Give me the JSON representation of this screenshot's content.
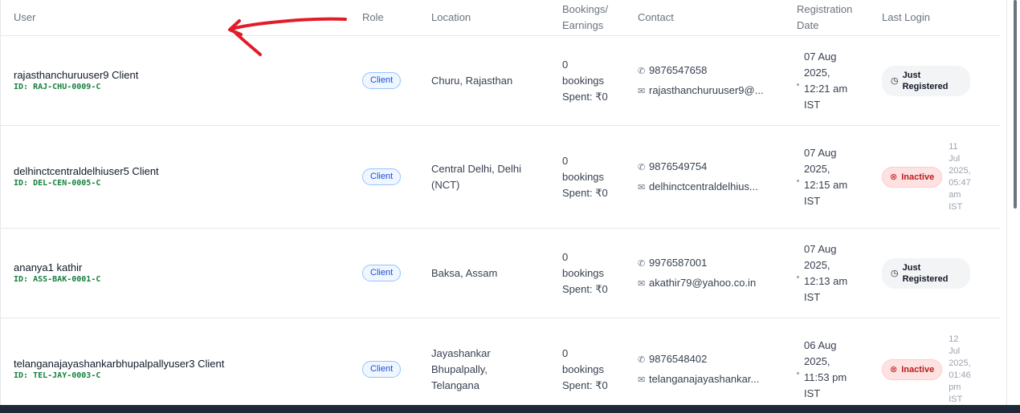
{
  "columns": {
    "user": "User",
    "role": "Role",
    "location": "Location",
    "bookings_1": "Bookings/",
    "bookings_2": "Earnings",
    "contact": "Contact",
    "registration_1": "Registration",
    "registration_2": "Date",
    "last_login": "Last Login"
  },
  "rows": [
    {
      "name": "rajasthanchuruuser9 Client",
      "id": "ID: RAJ-CHU-0009-C",
      "role": "Client",
      "location": [
        "Churu, Rajasthan"
      ],
      "bookings": [
        "0",
        "bookings",
        "Spent: ₹0"
      ],
      "phone": "9876547658",
      "email": "rajasthanchuruuser9@...",
      "registered": [
        "07 Aug",
        "2025,",
        "12:21 am",
        "IST"
      ],
      "status": [
        "Just",
        "Registered"
      ],
      "status_type": "just",
      "last_login": []
    },
    {
      "name": "delhinctcentraldelhiuser5 Client",
      "id": "ID: DEL-CEN-0005-C",
      "role": "Client",
      "location": [
        "Central Delhi, Delhi",
        "(NCT)"
      ],
      "bookings": [
        "0",
        "bookings",
        "Spent: ₹0"
      ],
      "phone": "9876549754",
      "email": "delhinctcentraldelhius...",
      "registered": [
        "07 Aug",
        "2025,",
        "12:15 am",
        "IST"
      ],
      "status": [
        "Inactive"
      ],
      "status_type": "inactive",
      "last_login": [
        "11",
        "Jul",
        "2025,",
        "05:47",
        "am",
        "IST"
      ]
    },
    {
      "name": "ananya1 kathir",
      "id": "ID: ASS-BAK-0001-C",
      "role": "Client",
      "location": [
        "Baksa, Assam"
      ],
      "bookings": [
        "0",
        "bookings",
        "Spent: ₹0"
      ],
      "phone": "9976587001",
      "email": "akathir79@yahoo.co.in",
      "registered": [
        "07 Aug",
        "2025,",
        "12:13 am",
        "IST"
      ],
      "status": [
        "Just",
        "Registered"
      ],
      "status_type": "just",
      "last_login": []
    },
    {
      "name": "telanganajayashankarbhupalpallyuser3 Client",
      "id": "ID: TEL-JAY-0003-C",
      "role": "Client",
      "location": [
        "Jayashankar",
        "Bhupalpally,",
        "Telangana"
      ],
      "bookings": [
        "0",
        "bookings",
        "Spent: ₹0"
      ],
      "phone": "9876548402",
      "email": "telanganajayashankar...",
      "registered": [
        "06 Aug",
        "2025,",
        "11:53 pm",
        "IST"
      ],
      "status": [
        "Inactive"
      ],
      "status_type": "inactive",
      "last_login": [
        "12",
        "Jul",
        "2025,",
        "01:46",
        "pm",
        "IST"
      ]
    }
  ],
  "icons": {
    "phone": "phone-icon",
    "email": "mail-icon",
    "just": "clock-icon",
    "inactive": "x-circle-icon"
  },
  "colors": {
    "id_text": "#15803d",
    "role_badge": "#1d4ed8",
    "inactive": "#b91c1c",
    "annotation_arrow": "#e11d2a"
  }
}
